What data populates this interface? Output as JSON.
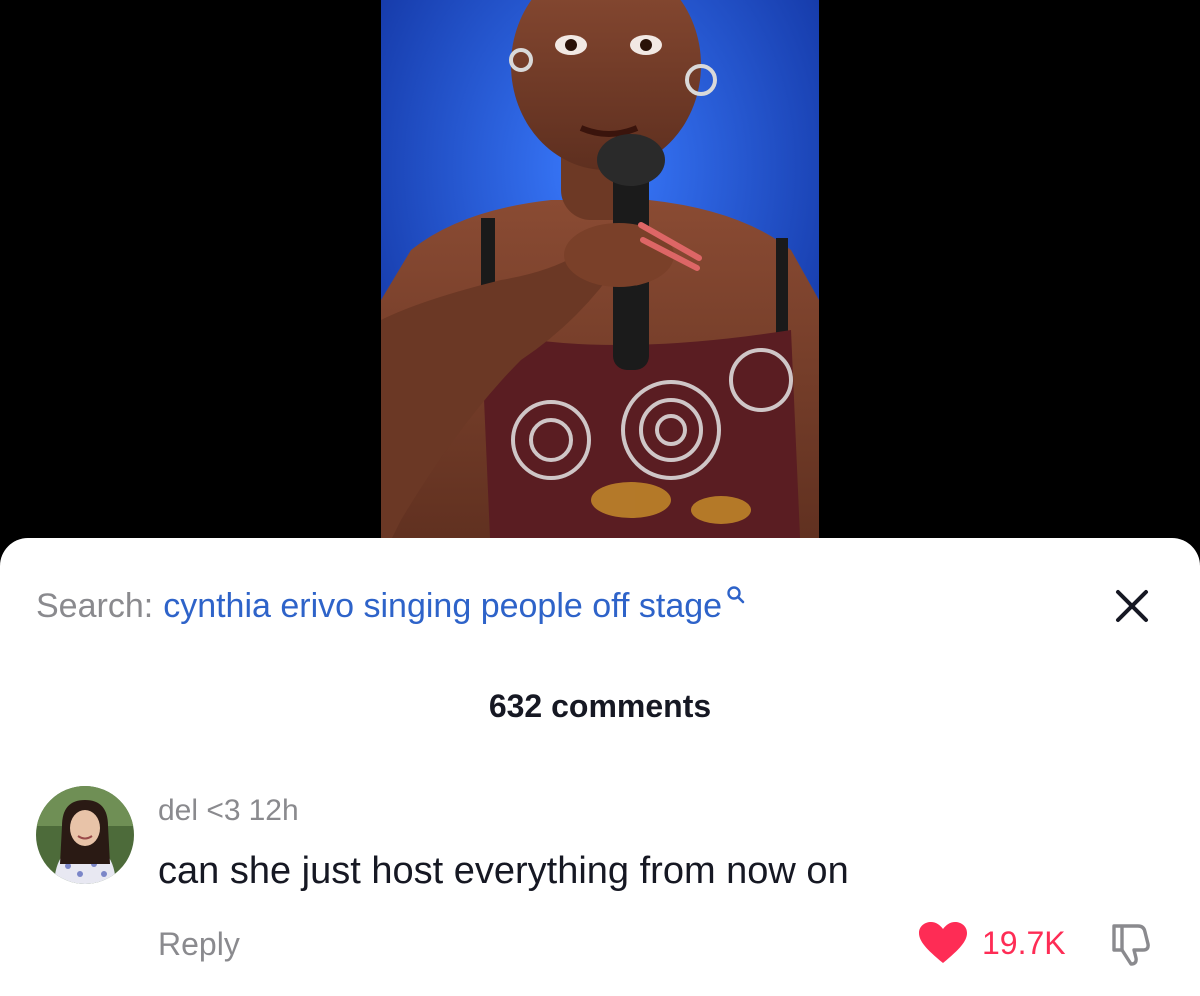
{
  "video": {
    "subject": "performer-holding-microphone-on-stage"
  },
  "search": {
    "prefix": "Search:",
    "query": "cynthia erivo singing people off stage",
    "icon": "search-icon"
  },
  "close": {
    "icon": "close-icon"
  },
  "comments": {
    "count_label": "632 comments"
  },
  "comment": {
    "username": "del <3",
    "time": "12h",
    "text": "can she just host everything from now on",
    "reply_label": "Reply",
    "likes": "19.7K",
    "like_icon": "heart-icon",
    "dislike_icon": "thumbs-down-icon"
  },
  "colors": {
    "accent_like": "#fe2c55",
    "search_link": "#2e63c9",
    "muted_text": "#8a8a8e",
    "primary_text": "#161823"
  }
}
